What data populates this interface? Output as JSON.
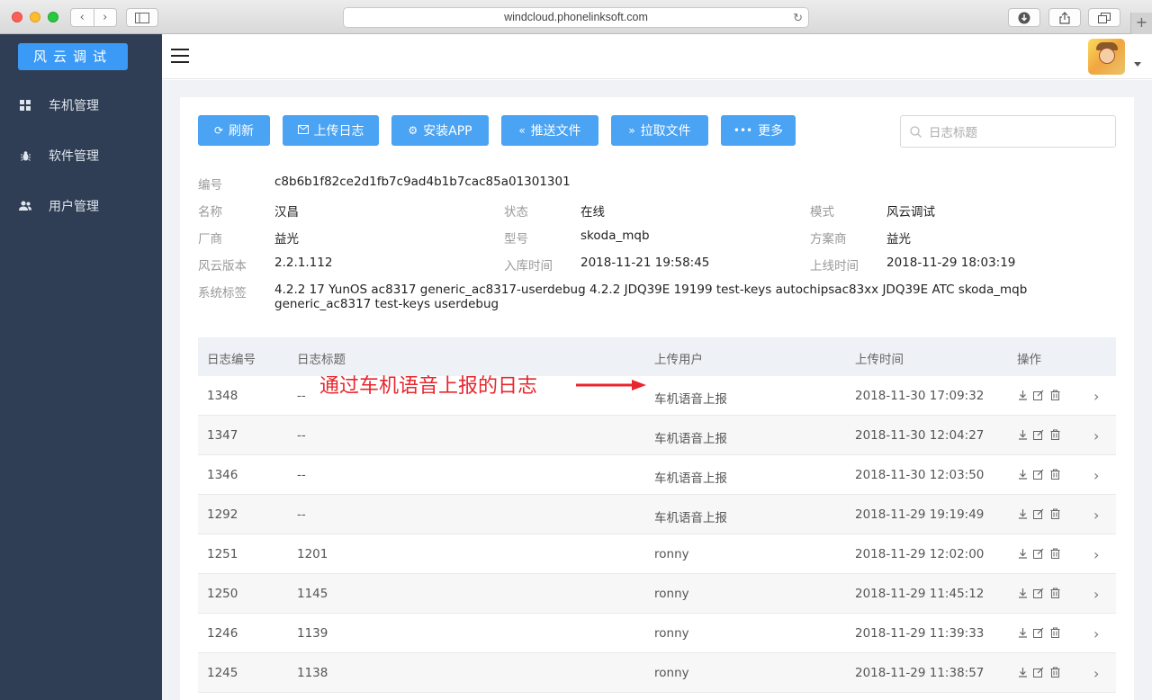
{
  "browser": {
    "url": "windcloud.phonelinksoft.com",
    "nav_back": "‹",
    "nav_forward": "›"
  },
  "sidebar": {
    "brand": "风云调试",
    "items": [
      {
        "label": "车机管理",
        "icon": "grid-icon"
      },
      {
        "label": "软件管理",
        "icon": "bug-icon"
      },
      {
        "label": "用户管理",
        "icon": "users-icon"
      }
    ]
  },
  "toolbar": {
    "buttons": [
      {
        "label": "刷新",
        "icon": "refresh-icon"
      },
      {
        "label": "上传日志",
        "icon": "mail-icon"
      },
      {
        "label": "安装APP",
        "icon": "gear-icon"
      },
      {
        "label": "推送文件",
        "icon": "double-left-icon"
      },
      {
        "label": "拉取文件",
        "icon": "double-right-icon"
      },
      {
        "label": "更多",
        "icon": "more-icon"
      }
    ],
    "search_placeholder": "日志标题"
  },
  "device": {
    "labels": {
      "id": "编号",
      "name": "名称",
      "status": "状态",
      "mode": "模式",
      "vendor": "厂商",
      "model": "型号",
      "solution": "方案商",
      "version": "风云版本",
      "stored": "入库时间",
      "online": "上线时间",
      "system": "系统标签"
    },
    "values": {
      "id": "c8b6b1f82ce2d1fb7c9ad4b1b7cac85a01301301",
      "name": "汉昌",
      "status": "在线",
      "mode": "风云调试",
      "vendor": "益光",
      "model": "skoda_mqb",
      "solution": "益光",
      "version": "2.2.1.112",
      "stored": "2018-11-21 19:58:45",
      "online": "2018-11-29 18:03:19",
      "system": "4.2.2 17 YunOS ac8317 generic_ac8317-userdebug 4.2.2 JDQ39E 19199 test-keys autochipsac83xx JDQ39E ATC skoda_mqb generic_ac8317 test-keys userdebug"
    }
  },
  "table": {
    "headers": [
      "日志编号",
      "日志标题",
      "上传用户",
      "上传时间",
      "操作"
    ],
    "rows": [
      {
        "id": "1348",
        "title": "--",
        "user": "车机语音上报",
        "time": "2018-11-30 17:09:32"
      },
      {
        "id": "1347",
        "title": "--",
        "user": "车机语音上报",
        "time": "2018-11-30 12:04:27"
      },
      {
        "id": "1346",
        "title": "--",
        "user": "车机语音上报",
        "time": "2018-11-30 12:03:50"
      },
      {
        "id": "1292",
        "title": "--",
        "user": "车机语音上报",
        "time": "2018-11-29 19:19:49"
      },
      {
        "id": "1251",
        "title": "1201",
        "user": "ronny",
        "time": "2018-11-29 12:02:00"
      },
      {
        "id": "1250",
        "title": "1145",
        "user": "ronny",
        "time": "2018-11-29 11:45:12"
      },
      {
        "id": "1246",
        "title": "1139",
        "user": "ronny",
        "time": "2018-11-29 11:39:33"
      },
      {
        "id": "1245",
        "title": "1138",
        "user": "ronny",
        "time": "2018-11-29 11:38:57"
      }
    ]
  },
  "annotation": {
    "text": "通过车机语音上报的日志",
    "color": "#e8262d"
  },
  "colors": {
    "sidebar_bg": "#2f3e54",
    "accent": "#4aa3f3"
  }
}
